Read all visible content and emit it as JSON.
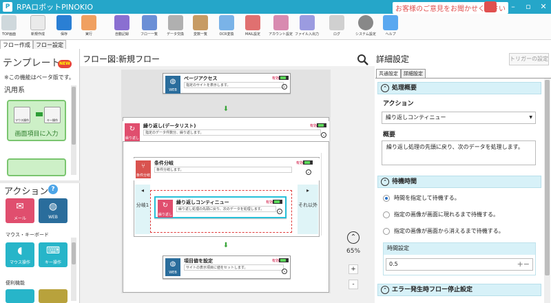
{
  "window": {
    "title": "RPAロボットPINOKIO",
    "feedback": "お客様のご意見をお聞かせください"
  },
  "toolbar": {
    "items": [
      {
        "label": "TOP画面",
        "color": "#cfd8dc"
      },
      {
        "label": "新規作成",
        "color": "#eaeaea"
      },
      {
        "label": "保存",
        "color": "#2a7fd4"
      },
      {
        "label": "実行",
        "color": "#f0a060"
      },
      {
        "label": "自動記録",
        "color": "#8a6fd1"
      },
      {
        "label": "フロー一覧",
        "color": "#6b8fd6"
      },
      {
        "label": "データ交換",
        "color": "#b0b0b0"
      },
      {
        "label": "変数一覧",
        "color": "#c79b64"
      },
      {
        "label": "OCR変換",
        "color": "#7ab3e8"
      },
      {
        "label": "MAIL設定",
        "color": "#e07070"
      },
      {
        "label": "アカウント設定",
        "color": "#d88ab0"
      },
      {
        "label": "ファイル入出力",
        "color": "#9b9be0"
      },
      {
        "label": "ログ",
        "color": "#d0d0d0"
      },
      {
        "label": "システム設定",
        "color": "#888888"
      },
      {
        "label": "ヘルプ",
        "color": "#5aa8f0"
      }
    ]
  },
  "left_tabs": [
    "フロー作成",
    "フロー設定"
  ],
  "templates": {
    "heading": "テンプレート",
    "badge": "NEW",
    "beta_note": "※この機能はベータ版です。",
    "category": "汎用系",
    "card": {
      "left_box": "マウス操作",
      "right_box": "キー操作",
      "caption": "画面項目に入力"
    }
  },
  "actions": {
    "heading": "アクション",
    "help": "?",
    "tiles_top": [
      {
        "label": "メール",
        "color": "#e04e6e",
        "icon": "mail-icon"
      },
      {
        "label": "WEB",
        "color": "#2a6d9c",
        "icon": "globe-icon"
      }
    ],
    "section_mouse": "マウス・キーボード",
    "tiles_mouse": [
      {
        "label": "マウス操作",
        "color": "#27b5c9",
        "icon": "mouse-icon"
      },
      {
        "label": "キー操作",
        "color": "#27b5c9",
        "icon": "keyboard-icon"
      }
    ],
    "section_util": "便利機能"
  },
  "canvas": {
    "title": "フロー図:新規フロー",
    "zoom": "65%",
    "plus": "+",
    "minus": "-",
    "nodes": {
      "page_access": {
        "title": "ページアクセス",
        "desc": "指定のサイトを表示します。",
        "flag": "有効",
        "icon": "WEB",
        "color": "#2a6d9c"
      },
      "loop": {
        "title": "繰り返し(データリスト)",
        "desc": "指定のデータ件数分、繰り返します。",
        "flag": "有効",
        "icon": "繰り返し",
        "color": "#e04e6e"
      },
      "condition": {
        "title": "条件分岐",
        "desc": "条件分岐します。",
        "flag": "有効",
        "icon": "条件分岐",
        "color": "#d9534f"
      },
      "continue": {
        "title": "繰り返しコンティニュー",
        "desc": "繰り返し処理の先頭に戻り、次のデータを処理します。",
        "flag": "有効",
        "icon": "繰り返し",
        "color": "#e04e6e"
      },
      "setvalue": {
        "title": "項目値を設定",
        "desc": "サイトの表示項目に値をセットします。",
        "flag": "有効",
        "icon": "WEB",
        "color": "#2a6d9c"
      }
    },
    "branch_left": "分岐1",
    "branch_right": "それ以外"
  },
  "details": {
    "title": "詳細設定",
    "trigger_button": "トリガーの設定",
    "tabs": [
      "共通設定",
      "詳細設定"
    ],
    "section_overview": "処理概要",
    "action_label": "アクション",
    "action_value": "繰り返しコンティニュー",
    "summary_label": "概要",
    "summary_value": "繰り返し処理の先頭に戻り、次のデータを処理します。",
    "section_wait": "待機時間",
    "radio_options": [
      {
        "label": "時間を指定して待機する。",
        "selected": true
      },
      {
        "label": "指定の画像が画面に現れるまで待機する。",
        "selected": false
      },
      {
        "label": "指定の画像が画面から消えるまで待機する。",
        "selected": false
      }
    ],
    "time_label": "時間設定",
    "time_value": "0.5",
    "section_error": "エラー発生時フロー停止設定"
  }
}
